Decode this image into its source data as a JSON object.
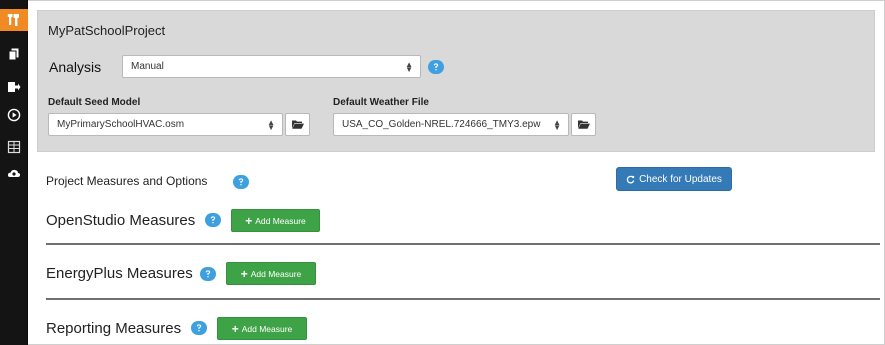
{
  "project": {
    "name": "MyPatSchoolProject"
  },
  "analysis": {
    "label": "Analysis",
    "selected": "Manual"
  },
  "seed_model": {
    "label": "Default Seed Model",
    "selected": "MyPrimarySchoolHVAC.osm"
  },
  "weather_file": {
    "label": "Default Weather File",
    "selected": "USA_CO_Golden-NREL.724666_TMY3.epw"
  },
  "project_measures": {
    "title": "Project Measures and Options"
  },
  "check_updates": {
    "label": "Check for Updates"
  },
  "sections": {
    "openstudio": {
      "title": "OpenStudio Measures",
      "add_label": "Add Measure"
    },
    "energyplus": {
      "title": "EnergyPlus Measures",
      "add_label": "Add Measure"
    },
    "reporting": {
      "title": "Reporting Measures",
      "add_label": "Add Measure"
    }
  },
  "sidebar": {
    "items": [
      {
        "icon": "tools-icon",
        "active": true
      },
      {
        "icon": "files-icon"
      },
      {
        "icon": "export-icon"
      },
      {
        "icon": "play-icon"
      },
      {
        "icon": "results-icon"
      },
      {
        "icon": "cloud-eye-icon"
      }
    ]
  },
  "colors": {
    "sidebar_bg": "#141414",
    "active_orange": "#f08a24",
    "panel_grey": "#d9d9d9",
    "help_blue": "#3fa0e0",
    "primary_blue": "#337ab7",
    "success_green": "#3ea346"
  }
}
